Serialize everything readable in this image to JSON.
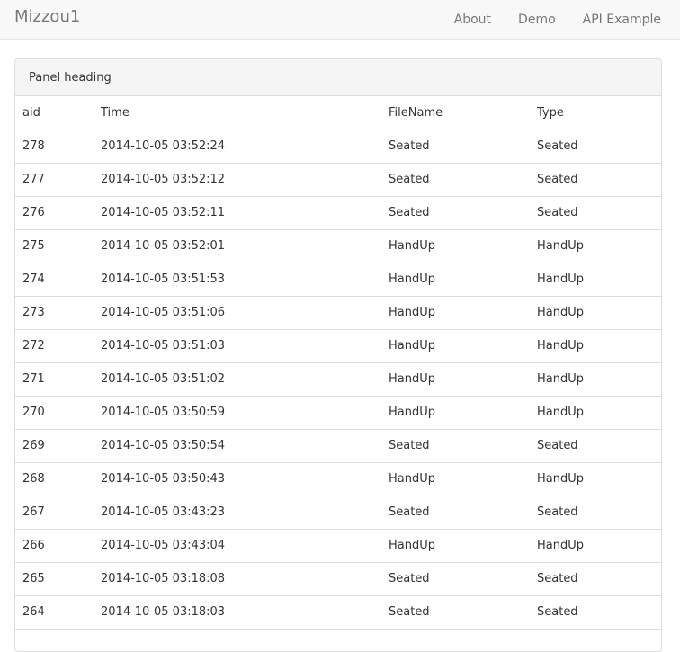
{
  "navbar": {
    "brand": "Mizzou1",
    "links": [
      "About",
      "Demo",
      "API Example"
    ]
  },
  "panel": {
    "heading": "Panel heading",
    "columns": [
      "aid",
      "Time",
      "FileName",
      "Type"
    ],
    "rows": [
      [
        "278",
        "2014-10-05 03:52:24",
        "Seated",
        "Seated"
      ],
      [
        "277",
        "2014-10-05 03:52:12",
        "Seated",
        "Seated"
      ],
      [
        "276",
        "2014-10-05 03:52:11",
        "Seated",
        "Seated"
      ],
      [
        "275",
        "2014-10-05 03:52:01",
        "HandUp",
        "HandUp"
      ],
      [
        "274",
        "2014-10-05 03:51:53",
        "HandUp",
        "HandUp"
      ],
      [
        "273",
        "2014-10-05 03:51:06",
        "HandUp",
        "HandUp"
      ],
      [
        "272",
        "2014-10-05 03:51:03",
        "HandUp",
        "HandUp"
      ],
      [
        "271",
        "2014-10-05 03:51:02",
        "HandUp",
        "HandUp"
      ],
      [
        "270",
        "2014-10-05 03:50:59",
        "HandUp",
        "HandUp"
      ],
      [
        "269",
        "2014-10-05 03:50:54",
        "Seated",
        "Seated"
      ],
      [
        "268",
        "2014-10-05 03:50:43",
        "HandUp",
        "HandUp"
      ],
      [
        "267",
        "2014-10-05 03:43:23",
        "Seated",
        "Seated"
      ],
      [
        "266",
        "2014-10-05 03:43:04",
        "HandUp",
        "HandUp"
      ],
      [
        "265",
        "2014-10-05 03:18:08",
        "Seated",
        "Seated"
      ],
      [
        "264",
        "2014-10-05 03:18:03",
        "Seated",
        "Seated"
      ]
    ]
  }
}
